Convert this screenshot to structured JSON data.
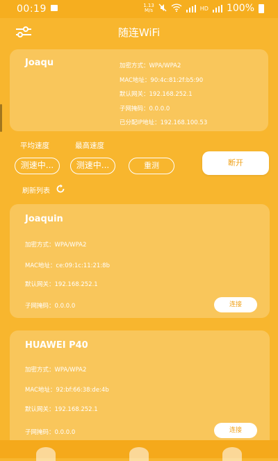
{
  "status_bar": {
    "time": "00:19",
    "speed": "1.13",
    "speed_unit": "M/s",
    "network_labels": "HD",
    "battery": "100%"
  },
  "app_bar": {
    "title": "随连WiFi"
  },
  "current": {
    "ssid": "Joaqu",
    "encryption": "加密方式：WPA/WPA2",
    "mac": "MAC地址：90:4c:81:2f:b5:90",
    "gateway": "默认网关：192.168.252.1",
    "subnet": "子网掩码：0.0.0.0",
    "ip": "已分配IP地址：192.168.100.53"
  },
  "speed": {
    "avg_label": "平均速度",
    "max_label": "最高速度",
    "avg_value": "测速中...",
    "max_value": "测速中...",
    "retest_label": "重测",
    "disconnect_label": "断开"
  },
  "refresh": {
    "label": "刷新列表"
  },
  "networks": [
    {
      "ssid": "Joaquin",
      "encryption": "加密方式：WPA/WPA2",
      "mac": "MAC地址：ce:09:1c:11:21:8b",
      "gateway": "默认网关：192.168.252.1",
      "subnet": "子网掩码：0.0.0.0",
      "connect_label": "连接"
    },
    {
      "ssid": "HUAWEI P40",
      "encryption": "加密方式：WPA/WPA2",
      "mac": "MAC地址：92:bf:66:38:de:4b",
      "gateway": "默认网关：192.168.252.1",
      "subnet": "子网掩码：0.0.0.0",
      "connect_label": "连接"
    }
  ],
  "colors": {
    "background": "#F8B62E",
    "accent_text": "#F0A21A"
  }
}
